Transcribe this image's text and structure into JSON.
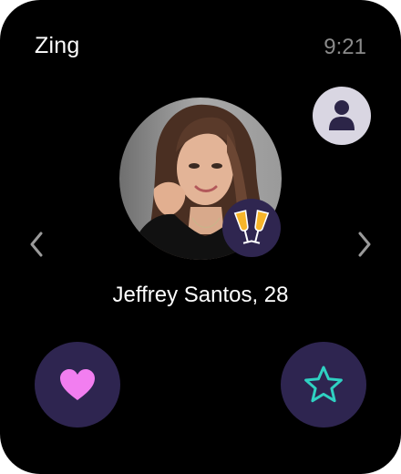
{
  "app": {
    "title": "Zing",
    "time": "9:21"
  },
  "profile": {
    "name_age": "Jeffrey Santos, 28",
    "badge_icon": "champagne-toast-icon"
  },
  "icons": {
    "profile": "person-icon",
    "prev": "chevron-left-icon",
    "next": "chevron-right-icon",
    "like": "heart-icon",
    "favorite": "star-icon"
  },
  "colors": {
    "background": "#000000",
    "button_bg": "#2e2550",
    "heart": "#f27ef0",
    "star": "#2fd1c2",
    "profile_button_bg": "#d9d6e2",
    "profile_icon": "#2c2548",
    "clock": "#8a8a8a"
  }
}
